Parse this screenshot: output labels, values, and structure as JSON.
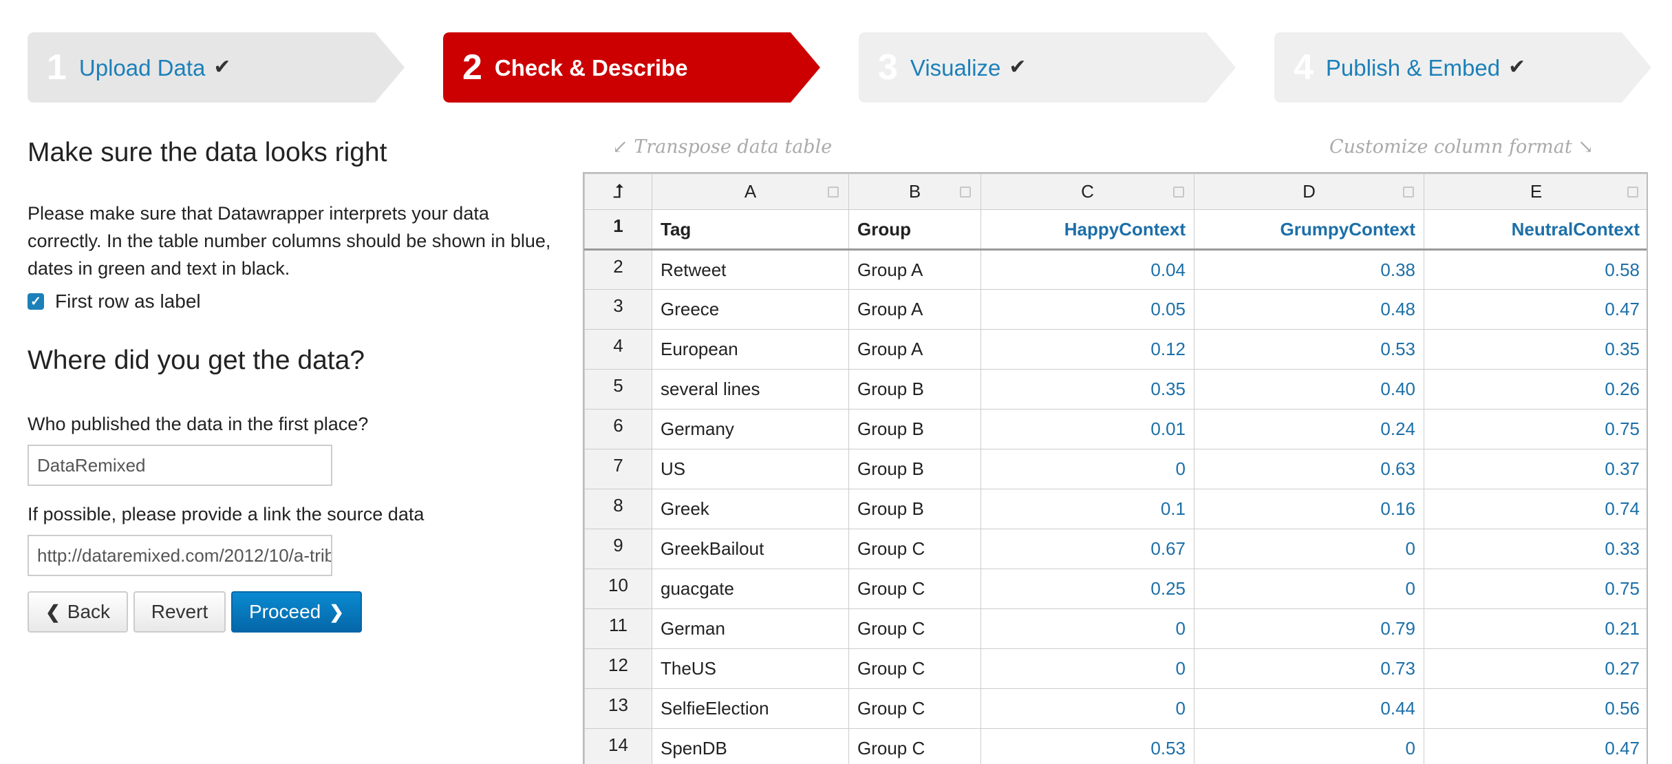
{
  "steps": [
    {
      "num": "1",
      "label": "Upload Data",
      "check": "✔",
      "state": "done"
    },
    {
      "num": "2",
      "label": "Check & Describe",
      "check": "",
      "state": "active"
    },
    {
      "num": "3",
      "label": "Visualize",
      "check": "✔",
      "state": "done"
    },
    {
      "num": "4",
      "label": "Publish & Embed",
      "check": "✔",
      "state": "done"
    }
  ],
  "left": {
    "heading": "Make sure the data looks right",
    "description": "Please make sure that Datawrapper interprets your data correctly. In the table number columns should be shown in blue, dates in green and text in black.",
    "first_row_label": "First row as label",
    "first_row_checked": true,
    "source_heading": "Where did you get the data?",
    "publisher_label": "Who published the data in the first place?",
    "publisher_value": "DataRemixed",
    "link_label": "If possible, please provide a link the source data",
    "link_value": "http://dataremixed.com/2012/10/a-trib",
    "back_label": "Back",
    "revert_label": "Revert",
    "proceed_label": "Proceed"
  },
  "hints": {
    "transpose": "Transpose data table",
    "customize": "Customize column format"
  },
  "table": {
    "corner_icon": "transpose-icon",
    "columns": [
      "A",
      "B",
      "C",
      "D",
      "E"
    ],
    "label_row": {
      "num": "1",
      "cells": [
        "Tag",
        "Group",
        "HappyContext",
        "GrumpyContext",
        "NeutralContext"
      ]
    },
    "rows": [
      {
        "num": "2",
        "cells": [
          "Retweet",
          "Group A",
          "0.04",
          "0.38",
          "0.58"
        ]
      },
      {
        "num": "3",
        "cells": [
          "Greece",
          "Group A",
          "0.05",
          "0.48",
          "0.47"
        ]
      },
      {
        "num": "4",
        "cells": [
          "European",
          "Group A",
          "0.12",
          "0.53",
          "0.35"
        ]
      },
      {
        "num": "5",
        "cells": [
          "several lines",
          "Group B",
          "0.35",
          "0.40",
          "0.26"
        ]
      },
      {
        "num": "6",
        "cells": [
          "Germany",
          "Group B",
          "0.01",
          "0.24",
          "0.75"
        ]
      },
      {
        "num": "7",
        "cells": [
          "US",
          "Group B",
          "0",
          "0.63",
          "0.37"
        ]
      },
      {
        "num": "8",
        "cells": [
          "Greek",
          "Group B",
          "0.1",
          "0.16",
          "0.74"
        ]
      },
      {
        "num": "9",
        "cells": [
          "GreekBailout",
          "Group C",
          "0.67",
          "0",
          "0.33"
        ]
      },
      {
        "num": "10",
        "cells": [
          "guacgate",
          "Group C",
          "0.25",
          "0",
          "0.75"
        ]
      },
      {
        "num": "11",
        "cells": [
          "German",
          "Group C",
          "0",
          "0.79",
          "0.21"
        ]
      },
      {
        "num": "12",
        "cells": [
          "TheUS",
          "Group C",
          "0",
          "0.73",
          "0.27"
        ]
      },
      {
        "num": "13",
        "cells": [
          "SelfieElection",
          "Group C",
          "0",
          "0.44",
          "0.56"
        ]
      },
      {
        "num": "14",
        "cells": [
          "SpenDB",
          "Group C",
          "0.53",
          "0",
          "0.47"
        ]
      }
    ]
  },
  "colors": {
    "active_step": "#cc0000",
    "inactive_step": "#ededed",
    "link_blue": "#1c80b9",
    "number_blue": "#1c6fa8",
    "proceed_button": "#0a7bc2"
  }
}
